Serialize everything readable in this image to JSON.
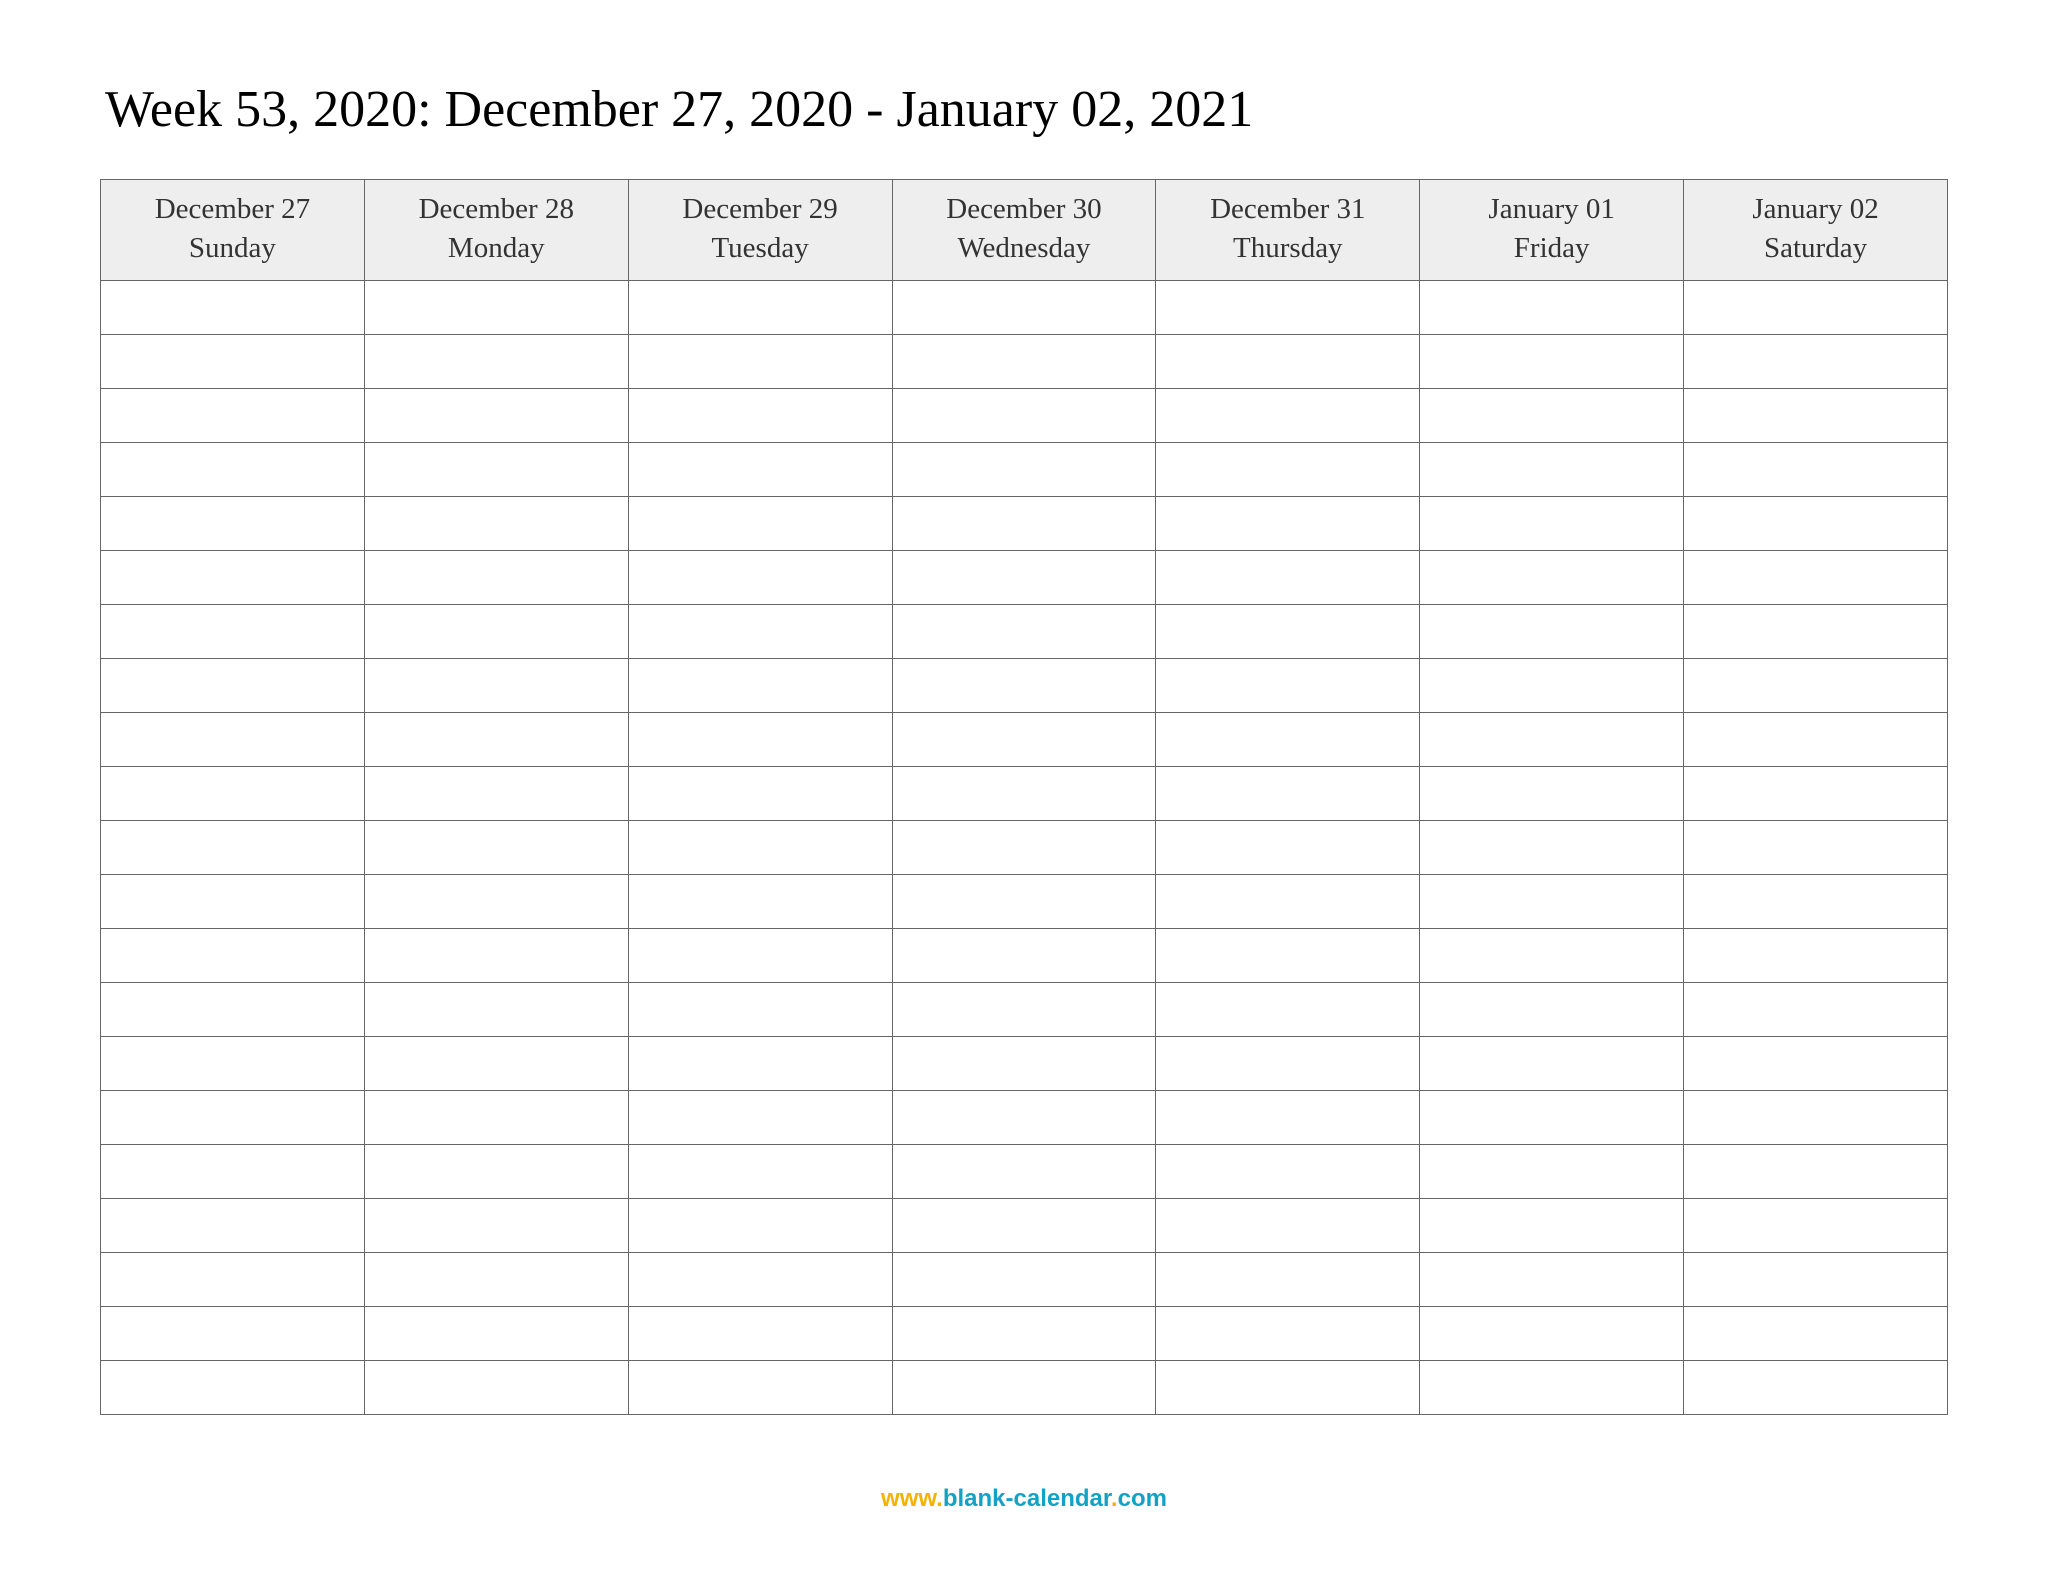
{
  "title": "Week 53, 2020: December 27, 2020 - January 02, 2021",
  "columns": [
    {
      "date": "December 27",
      "dow": "Sunday"
    },
    {
      "date": "December 28",
      "dow": "Monday"
    },
    {
      "date": "December 29",
      "dow": "Tuesday"
    },
    {
      "date": "December 30",
      "dow": "Wednesday"
    },
    {
      "date": "December 31",
      "dow": "Thursday"
    },
    {
      "date": "January 01",
      "dow": "Friday"
    },
    {
      "date": "January 02",
      "dow": "Saturday"
    }
  ],
  "row_count": 21,
  "footer": {
    "www": "www",
    "domain": "blank-calendar",
    "dot_before_domain": ".",
    "dot_before_tld": ".",
    "tld": "com"
  }
}
